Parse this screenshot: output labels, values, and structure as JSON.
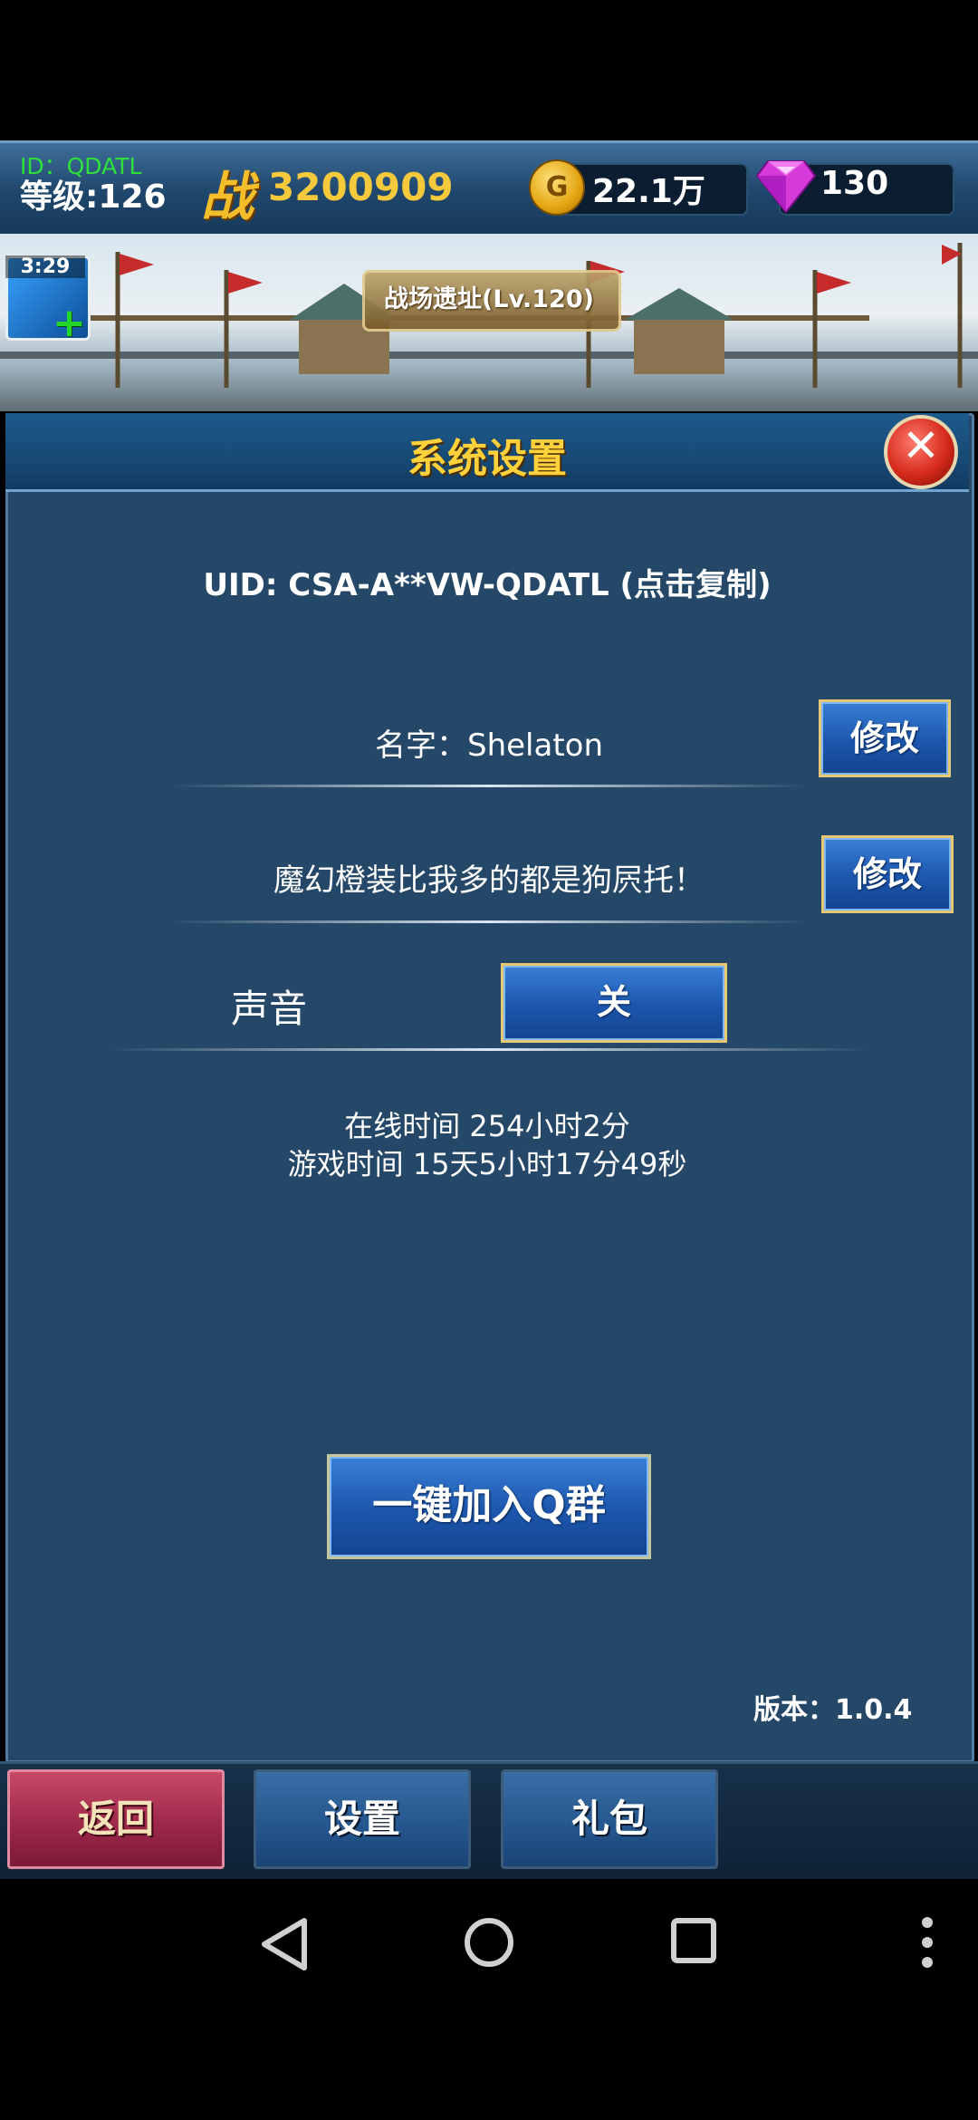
{
  "topbar": {
    "player_id": "ID：QDATL",
    "level": "等级:126",
    "power_glyph": "战",
    "power_value": "3200909",
    "gold_symbol": "G",
    "gold_value": "22.1万",
    "gem_value": "130"
  },
  "scene": {
    "timer": "3:29",
    "location": "战场遗址(Lv.120)"
  },
  "dialog": {
    "title": "系统设置",
    "close_symbol": "✕",
    "uid": "UID: CSA-A**VW-QDATL (点击复制)",
    "name_label": "名字：Shelaton",
    "slogan": "魔幻橙装比我多的都是狗屄托！",
    "edit_label": "修改",
    "sound_label": "声音",
    "sound_state": "关",
    "online_time": "在线时间 254小时2分",
    "game_time": "游戏时间 15天5小时17分49秒",
    "join_group": "一键加入Q群",
    "version": "版本：1.0.4"
  },
  "tabs": {
    "back": "返回",
    "settings": "设置",
    "gifts": "礼包"
  },
  "colors": {
    "panel_bg": "#264868",
    "title_gold": "#ffd23b",
    "button_blue": "#1c56ac",
    "button_border": "#e6c874",
    "back_tab": "#9a2648"
  },
  "icons": {
    "nav_back": "triangle-back-icon",
    "nav_home": "circle-home-icon",
    "nav_recents": "square-recents-icon",
    "nav_menu": "three-dots-menu-icon"
  }
}
